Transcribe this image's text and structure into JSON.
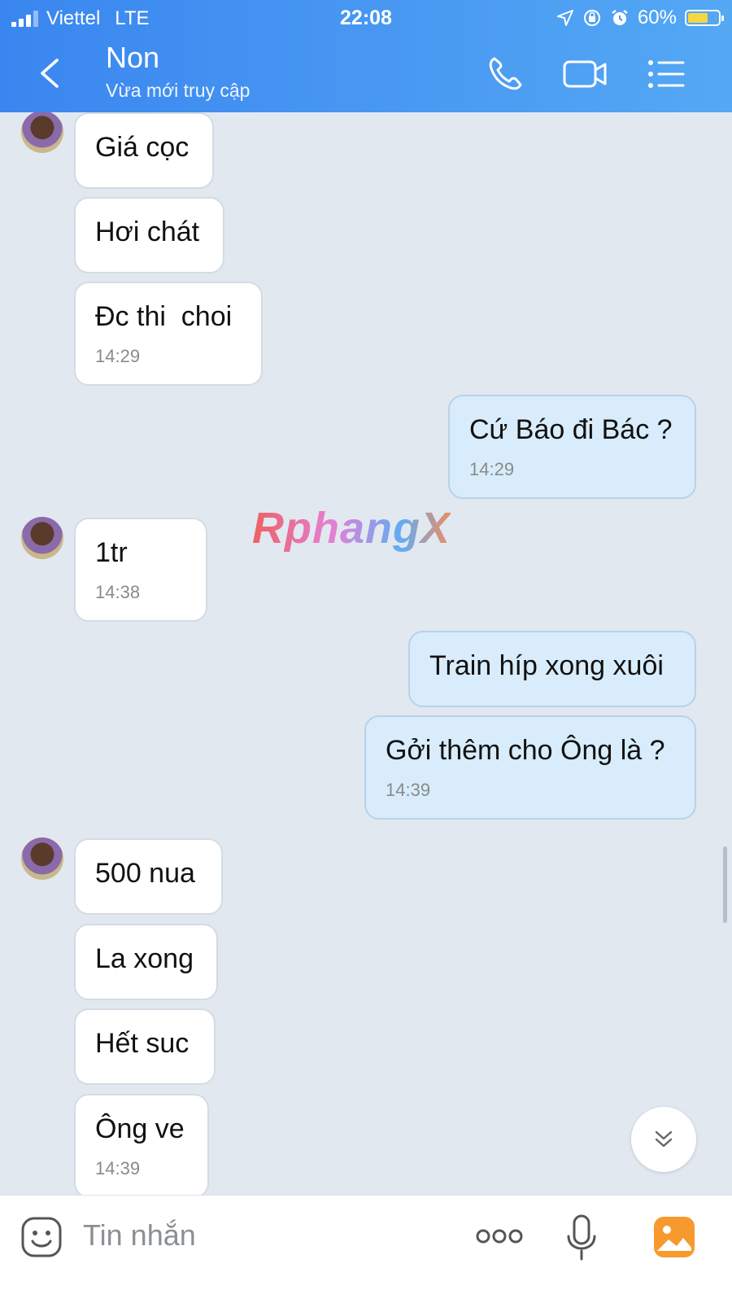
{
  "status_bar": {
    "carrier": "Viettel",
    "network": "LTE",
    "time": "22:08",
    "battery": "60%",
    "battery_level": 0.6
  },
  "header": {
    "title": "Non",
    "subtitle": "Vừa mới truy cập",
    "icons": [
      "back-chevron-icon",
      "phone-icon",
      "video-camera-icon",
      "menu-list-icon"
    ],
    "color": "#3a86f0"
  },
  "messages": [
    {
      "from": "them",
      "text": "Giá cọc"
    },
    {
      "from": "them",
      "text": "Hơi chát"
    },
    {
      "from": "them",
      "text": "Đc thi  choi",
      "time": "14:29"
    },
    {
      "from": "me",
      "text": "Cứ Báo đi Bác ?",
      "time": "14:29"
    },
    {
      "from": "them",
      "text": "1tr",
      "time": "14:38"
    },
    {
      "from": "me",
      "text": "Train híp xong xuôi"
    },
    {
      "from": "me",
      "text": "Gởi thêm cho Ông là ?",
      "time": "14:39"
    },
    {
      "from": "them",
      "text": "500 nua"
    },
    {
      "from": "them",
      "text": "La xong"
    },
    {
      "from": "them",
      "text": "Hết suc"
    },
    {
      "from": "them",
      "text": "Ông ve",
      "time": "14:39"
    }
  ],
  "watermark": "RphangX",
  "input": {
    "placeholder": "Tin nhắn",
    "icons": [
      "emoji-icon",
      "more-icon",
      "microphone-icon",
      "gallery-icon"
    ]
  }
}
